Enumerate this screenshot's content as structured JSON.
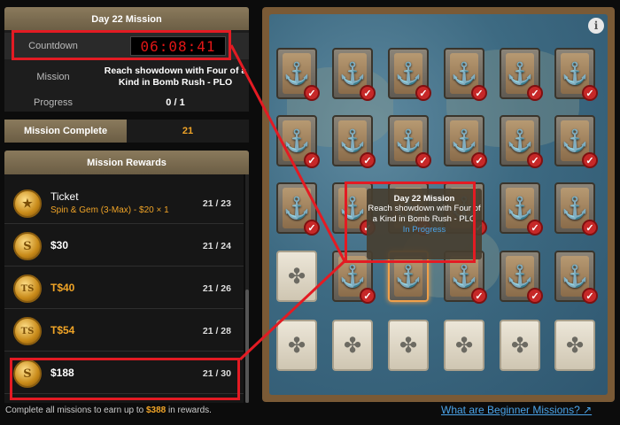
{
  "mission": {
    "header": "Day 22 Mission",
    "countdown_label": "Countdown",
    "countdown": "06:08:41",
    "mission_label": "Mission",
    "mission_text": "Reach showdown with Four of a Kind in Bomb Rush - PLO",
    "progress_label": "Progress",
    "progress": "0 / 1"
  },
  "complete": {
    "label": "Mission Complete",
    "value": "21"
  },
  "rewards": {
    "header": "Mission Rewards",
    "items": [
      {
        "type": "ticket",
        "name": "Ticket",
        "detail": "Spin & Gem (3-Max) - $20 × 1",
        "count": "21 / 23",
        "coin": "★"
      },
      {
        "type": "cash",
        "name": "$30",
        "count": "21 / 24",
        "coin": "S"
      },
      {
        "type": "tcash",
        "name": "T$40",
        "count": "21 / 26",
        "coin": "TS"
      },
      {
        "type": "tcash",
        "name": "T$54",
        "count": "21 / 28",
        "coin": "TS"
      },
      {
        "type": "cash",
        "name": "$188",
        "count": "21 / 30",
        "coin": "S"
      }
    ]
  },
  "footer": {
    "prefix": "Complete all missions to earn up to ",
    "amount": "$388",
    "suffix": " in rewards."
  },
  "help_link": "What are Beginner Missions? ↗",
  "board": {
    "info_icon": "i",
    "tooltip": {
      "title": "Day 22 Mission",
      "desc": "Reach showdown with Four of a Kind in Bomb Rush - PLO",
      "status": "In Progress"
    },
    "rows": [
      [
        "done",
        "done",
        "done",
        "done",
        "done",
        "done"
      ],
      [
        "done",
        "done",
        "done",
        "done",
        "done",
        "done"
      ],
      [
        "done",
        "done",
        "done",
        "done",
        "done",
        "done"
      ],
      [
        "todo",
        "done",
        "current",
        "done",
        "done",
        "done"
      ],
      [
        "todo",
        "todo",
        "todo",
        "todo",
        "todo",
        "todo"
      ]
    ],
    "icons": {
      "done": "anchor-icon",
      "todo": "compass-icon"
    },
    "colors": {
      "highlight": "#e31b23",
      "accent": "#f0a427",
      "link": "#4aa3e8"
    }
  }
}
